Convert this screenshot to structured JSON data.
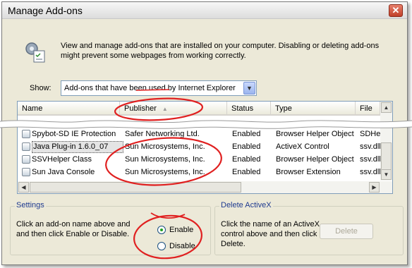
{
  "window": {
    "title": "Manage Add-ons",
    "close_label": "✕"
  },
  "intro": {
    "text": "View and manage add-ons that are installed on your computer. Disabling or deleting add-ons might prevent some webpages from working correctly."
  },
  "show": {
    "label": "Show:",
    "selected": "Add-ons that have been used by Internet Explorer"
  },
  "list": {
    "columns": [
      "Name",
      "Publisher",
      "Status",
      "Type",
      "File"
    ],
    "sort_indicator": "▲",
    "rows": [
      {
        "name": "Spybot-SD IE Protection",
        "publisher": "Safer Networking Ltd.",
        "status": "Enabled",
        "type": "Browser Helper Object",
        "file": "SDHelp"
      },
      {
        "name": "Java Plug-in 1.6.0_07",
        "publisher": "Sun Microsystems, Inc.",
        "status": "Enabled",
        "type": "ActiveX Control",
        "file": "ssv.dll"
      },
      {
        "name": "SSVHelper Class",
        "publisher": "Sun Microsystems, Inc.",
        "status": "Enabled",
        "type": "Browser Helper Object",
        "file": "ssv.dll"
      },
      {
        "name": "Sun Java Console",
        "publisher": "Sun Microsystems, Inc.",
        "status": "Enabled",
        "type": "Browser Extension",
        "file": "ssv.dll"
      }
    ]
  },
  "settings": {
    "legend": "Settings",
    "description": "Click an add-on name above and and then click Enable or Disable.",
    "enable_label": "Enable",
    "disable_label": "Disable",
    "selected": "Enable"
  },
  "delete_activex": {
    "legend": "Delete ActiveX",
    "description": "Click the name of an ActiveX control above and then click Delete.",
    "button_label": "Delete"
  },
  "colors": {
    "annotation": "#e02020",
    "legend_text": "#1e3a8f",
    "window_bg": "#ece9d8"
  }
}
